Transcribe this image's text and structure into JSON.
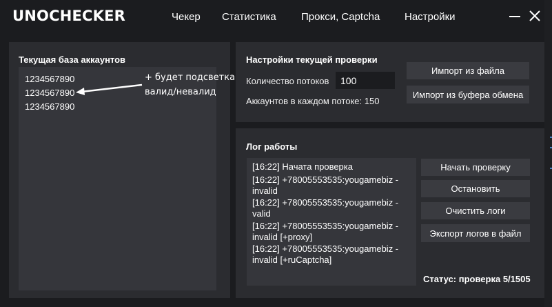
{
  "app": {
    "title": "UNOCHECKER"
  },
  "nav": {
    "items": [
      {
        "label": "Чекер"
      },
      {
        "label": "Статистика"
      },
      {
        "label": "Прокси, Captcha"
      },
      {
        "label": "Настройки"
      }
    ]
  },
  "window": {
    "minimize_icon": "minimize-icon",
    "close_icon": "close-icon"
  },
  "accounts": {
    "title": "Текущая база аккаунтов",
    "lines": [
      "1234567890",
      "1234567890",
      "1234567890"
    ],
    "annotation": {
      "line1": "+ будет подсветка",
      "line2": "валид/невалид"
    }
  },
  "settings": {
    "title": "Настройки текущей проверки",
    "threads_label": "Количество потоков",
    "threads_value": "100",
    "per_thread_label": "Аккаунтов в каждом потоке: 150",
    "import_file_label": "Импорт из файла",
    "import_clipboard_label": "Импорт из буфера обмена"
  },
  "log": {
    "title": "Лог работы",
    "entries": [
      "[16:22]  Начата проверка",
      "[16:22] +78005553535:yougamebiz - invalid",
      "[16:22] +78005553535:yougamebiz - valid",
      "[16:22] +78005553535:yougamebiz - invalid [+proxy]",
      "[16:22] +78005553535:yougamebiz - invalid [+ruCaptcha]"
    ],
    "start_label": "Начать проверку",
    "stop_label": "Остановить",
    "clear_label": "Очистить логи",
    "export_label": "Экспорт логов в файл",
    "status": "Статус: проверка 5/1505"
  },
  "colors": {
    "background": "#1b1c1f",
    "panel": "#2b2c30",
    "inner_box": "#35363b",
    "button": "#3a3b40",
    "text": "#ffffff"
  }
}
